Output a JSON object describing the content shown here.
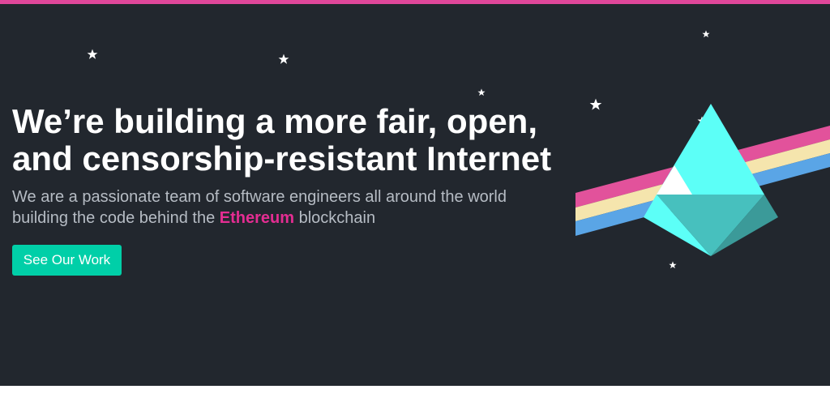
{
  "colors": {
    "top_bar": "#e0479a",
    "hero_bg": "#22272e",
    "headline": "#ffffff",
    "subtext": "#b6bcc4",
    "accent": "#e42d92",
    "button_bg": "#00cfa8",
    "button_text": "#ffffff",
    "stripe_pink": "#e2529b",
    "stripe_cream": "#f5e5ad",
    "stripe_blue": "#5aa5e6",
    "gem_light": "#5cfff7",
    "gem_mid": "#47c0be",
    "gem_dark": "#3b9a99",
    "gem_white": "#ffffff",
    "star": "#ffffff"
  },
  "hero": {
    "headline_line1": "We’re building a more fair, open,",
    "headline_line2": "and censorship-resistant Internet",
    "sub_line1": "We are a passionate team of software engineers all around the world",
    "sub_line2_prefix": "building the code behind the",
    "sub_accent": "Ethereum",
    "sub_line2_suffix": "blockchain",
    "cta_label": "See Our Work"
  },
  "decor": {
    "stars_icon": "star-icon",
    "illustration_icon": "ethereum-prism-illustration"
  }
}
